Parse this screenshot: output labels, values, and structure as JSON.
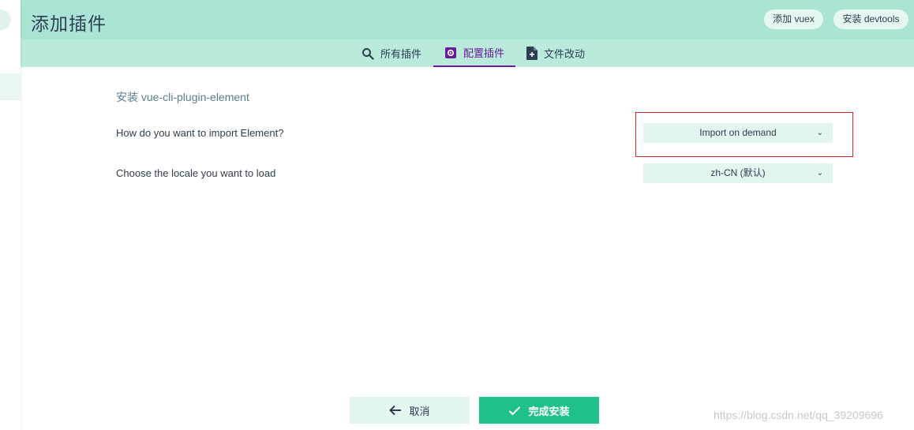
{
  "header": {
    "title": "添加插件",
    "buttons": [
      {
        "label": "添加 vuex"
      },
      {
        "label": "安装 devtools"
      }
    ]
  },
  "tabs": [
    {
      "label": "所有插件",
      "icon": "search-icon"
    },
    {
      "label": "配置插件",
      "icon": "plugin-gear-icon",
      "active": true
    },
    {
      "label": "文件改动",
      "icon": "file-diff-icon"
    }
  ],
  "config": {
    "title": "安装 vue-cli-plugin-element",
    "prompts": [
      {
        "label": "How do you want to import Element?",
        "value": "Import on demand"
      },
      {
        "label": "Choose the locale you want to load",
        "value": "zh-CN (默认)"
      }
    ]
  },
  "actions": {
    "cancel": "取消",
    "finish": "完成安装"
  },
  "watermark": "https://blog.csdn.net/qq_39209696",
  "colors": {
    "header_bg": "#aae4d4",
    "tabbar_bg": "#b9eadc",
    "active_tab": "#6a1b9a",
    "primary_button": "#20c08a",
    "highlight_border": "#d9282b"
  }
}
